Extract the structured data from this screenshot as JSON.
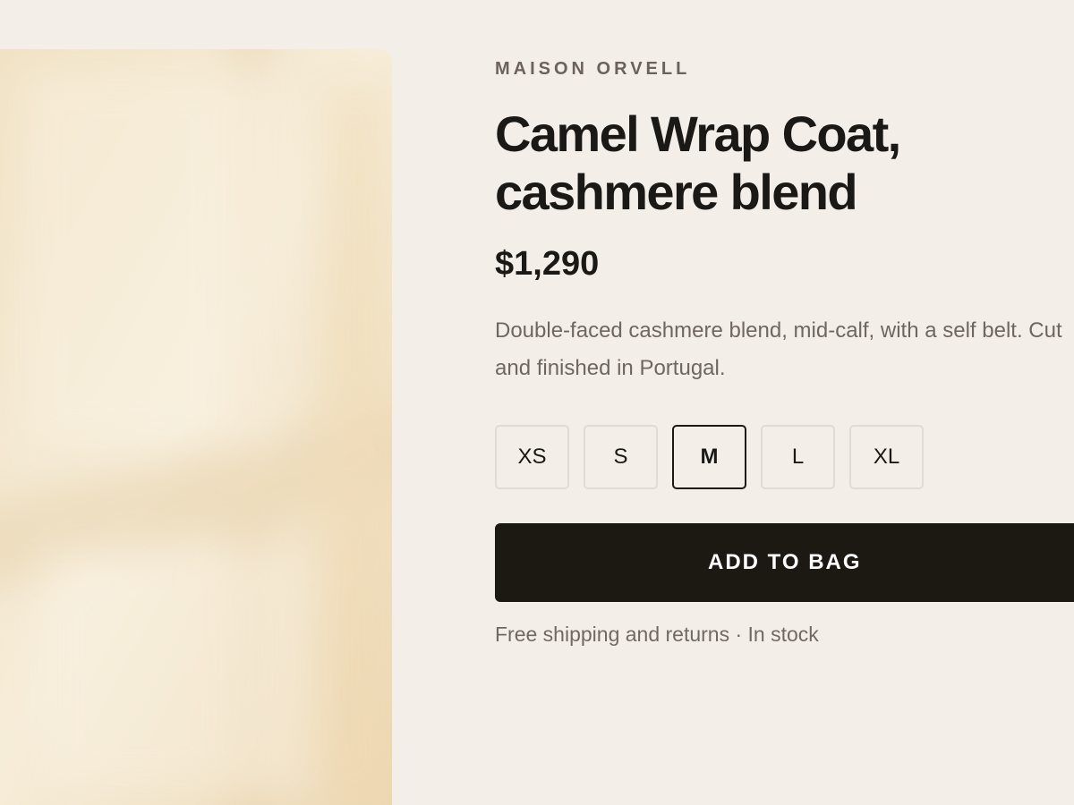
{
  "product": {
    "brand": "MAISON ORVELL",
    "title": "Camel Wrap Coat, cashmere blend",
    "price": "$1,290",
    "description": "Double-faced cashmere blend, mid-calf, with a self belt. Cut and finished in Portugal.",
    "sizes": [
      {
        "label": "XS",
        "selected": false
      },
      {
        "label": "S",
        "selected": false
      },
      {
        "label": "M",
        "selected": true
      },
      {
        "label": "L",
        "selected": false
      },
      {
        "label": "XL",
        "selected": false
      }
    ],
    "add_to_bag_label": "ADD TO BAG",
    "shipping_note": "Free shipping and returns · In stock"
  },
  "colors": {
    "background": "#f3efe8",
    "primary_text": "#1b1915",
    "secondary_text": "#6f675f",
    "button_background": "#1c1913",
    "size_border": "#e1dbd2"
  }
}
